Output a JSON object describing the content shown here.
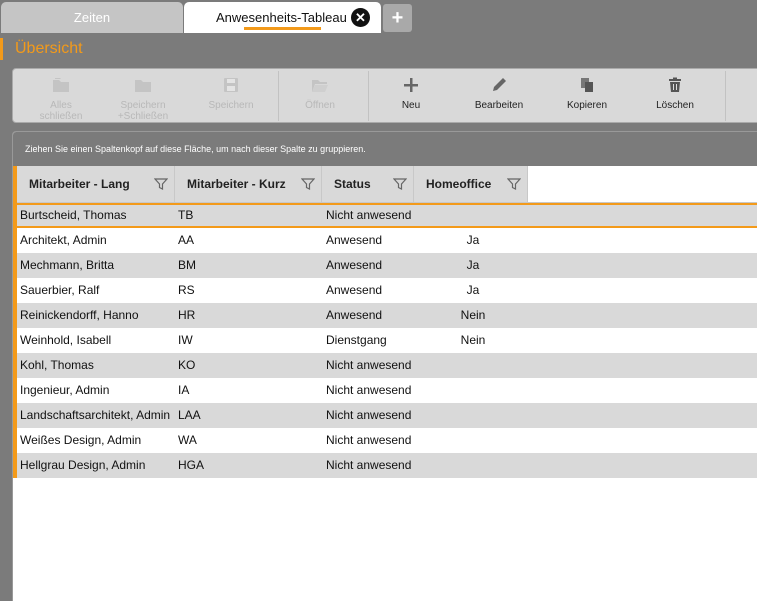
{
  "tabs": [
    {
      "label": "Zeiten"
    },
    {
      "label": "Anwesenheits-Tableau"
    }
  ],
  "tab_close_glyph": "✕",
  "tab_add_glyph": "+",
  "page_title": "Übersicht",
  "toolbar": [
    {
      "label": "Alles\nschließen",
      "icon": "folder-close-all-icon",
      "enabled": false
    },
    {
      "label": "Speichern\n+Schließen",
      "icon": "folder-save-close-icon",
      "enabled": false
    },
    {
      "label": "Speichern",
      "icon": "floppy-disk-icon",
      "enabled": false
    },
    {
      "label": "Öffnen",
      "icon": "folder-open-icon",
      "enabled": false
    },
    {
      "label": "Neu",
      "icon": "plus-icon",
      "enabled": true
    },
    {
      "label": "Bearbeiten",
      "icon": "pencil-icon",
      "enabled": true
    },
    {
      "label": "Kopieren",
      "icon": "copy-icon",
      "enabled": true
    },
    {
      "label": "Löschen",
      "icon": "trash-icon",
      "enabled": true
    }
  ],
  "group_hint": "Ziehen Sie einen Spaltenkopf auf diese Fläche, um nach dieser Spalte zu gruppieren.",
  "columns": [
    "Mitarbeiter - Lang",
    "Mitarbeiter - Kurz",
    "Status",
    "Homeoffice"
  ],
  "rows": [
    {
      "name": "Burtscheid, Thomas",
      "kurz": "TB",
      "status": "Nicht anwesend",
      "home": ""
    },
    {
      "name": "Architekt, Admin",
      "kurz": "AA",
      "status": "Anwesend",
      "home": "Ja"
    },
    {
      "name": "Mechmann, Britta",
      "kurz": "BM",
      "status": "Anwesend",
      "home": "Ja"
    },
    {
      "name": "Sauerbier, Ralf",
      "kurz": "RS",
      "status": "Anwesend",
      "home": "Ja"
    },
    {
      "name": "Reinickendorff, Hanno",
      "kurz": "HR",
      "status": "Anwesend",
      "home": "Nein"
    },
    {
      "name": "Weinhold, Isabell",
      "kurz": "IW",
      "status": "Dienstgang",
      "home": "Nein"
    },
    {
      "name": "Kohl, Thomas",
      "kurz": "KO",
      "status": "Nicht anwesend",
      "home": ""
    },
    {
      "name": "Ingenieur, Admin",
      "kurz": "IA",
      "status": "Nicht anwesend",
      "home": ""
    },
    {
      "name": "Landschaftsarchitekt, Admin",
      "kurz": "LAA",
      "status": "Nicht anwesend",
      "home": ""
    },
    {
      "name": "Weißes Design, Admin",
      "kurz": "WA",
      "status": "Nicht anwesend",
      "home": ""
    },
    {
      "name": "Hellgrau Design, Admin",
      "kurz": "HGA",
      "status": "Nicht anwesend",
      "home": ""
    }
  ],
  "selected_row": 0,
  "colors": {
    "accent": "#f39a1a",
    "background": "#7b7b7b",
    "row_alt": "#d9d9d9"
  }
}
